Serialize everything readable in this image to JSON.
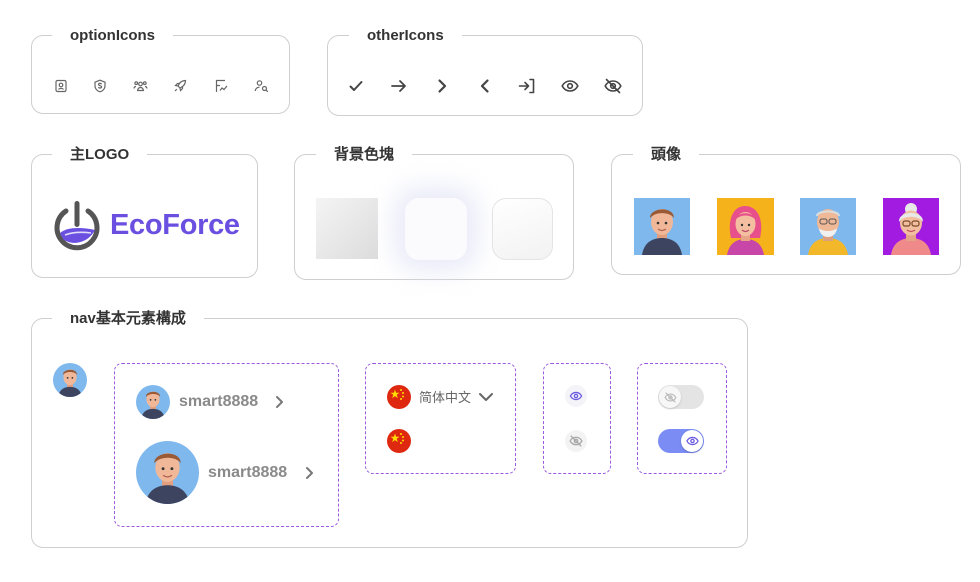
{
  "sections": {
    "option_icons": "optionIcons",
    "other_icons": "otherIcons",
    "main_logo": "主LOGO",
    "bg_blocks": "背景色塊",
    "avatars": "頭像",
    "nav_elements": "nav基本元素構成"
  },
  "option_icons": [
    "id-badge-icon",
    "dollar-shield-icon",
    "users-group-icon",
    "rocket-icon",
    "flag-chart-icon",
    "user-search-icon"
  ],
  "other_icons": [
    "check-icon",
    "arrow-right-icon",
    "chevron-right-icon",
    "chevron-left-icon",
    "login-icon",
    "eye-icon",
    "eye-off-icon"
  ],
  "logo": {
    "text": "EcoForce",
    "color": "#6a4fe0"
  },
  "avatars": [
    "avatar-young-man",
    "avatar-pink-hair-woman",
    "avatar-old-man",
    "avatar-old-woman"
  ],
  "nav": {
    "username_small": "smart8888",
    "username_large": "smart8888",
    "language": "简体中文"
  },
  "colors": {
    "accent": "#7b8cf5",
    "dash": "#9b59e0",
    "avatar_bg_blue": "#7fb8ec",
    "avatar_bg_yellow": "#f6b21b",
    "avatar_bg_purple": "#a11be0"
  }
}
